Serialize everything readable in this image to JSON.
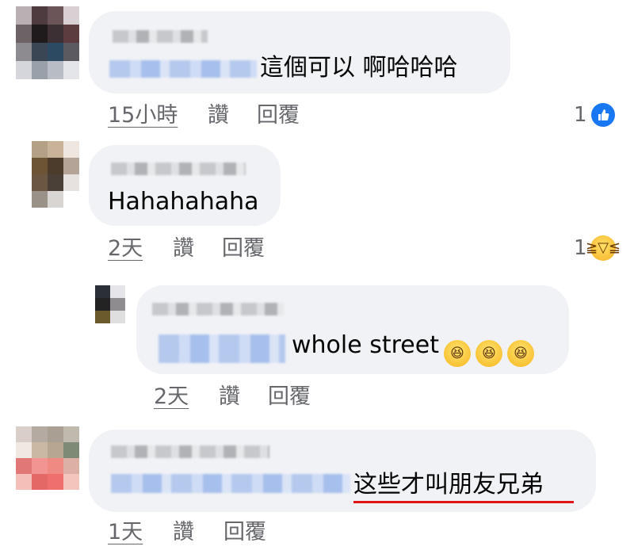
{
  "comments": [
    {
      "text": "這個可以 啊哈哈哈",
      "time": "15小時",
      "like_label": "讚",
      "reply_label": "回覆",
      "reaction_count": "1",
      "reaction": "like-icon"
    },
    {
      "text": "Hahahahaha",
      "time": "2天",
      "like_label": "讚",
      "reply_label": "回覆",
      "reaction_count": "1",
      "reaction": "laughing-reaction-icon"
    },
    {
      "text": "whole street",
      "emoji": [
        "😆",
        "😆",
        "😆"
      ],
      "time": "2天",
      "like_label": "讚",
      "reply_label": "回覆"
    },
    {
      "text": "这些才叫朋友兄弟",
      "time": "1天",
      "like_label": "讚",
      "reply_label": "回覆",
      "highlight_color": "#e0161b"
    }
  ],
  "colors": {
    "bubble": "#f0f2f5",
    "meta_text": "#65676b",
    "like_blue": "#1877f2"
  }
}
